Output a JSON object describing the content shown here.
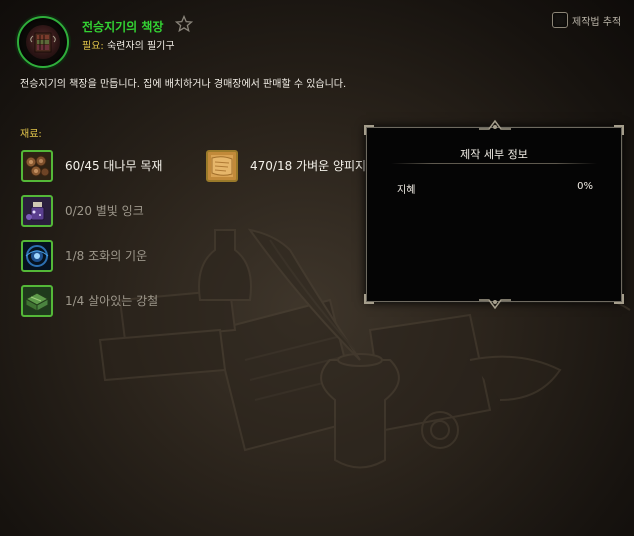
{
  "recipe": {
    "title": "전승지기의 책장",
    "required_label": "필요:",
    "required_value": "숙련자의 필기구",
    "description": "전승지기의 책장을 만듭니다. 집에 배치하거나 경매장에서 판매할 수 있습니다."
  },
  "tracking": {
    "label": "제작법 추적",
    "checked": false
  },
  "reagents": {
    "label": "재료:",
    "items": [
      {
        "text": "60/45 대나무 목재",
        "icon": "bamboo-lumber-icon",
        "enough": true
      },
      {
        "text": "470/18 가벼운 양피지",
        "icon": "light-parchment-icon",
        "enough": true
      },
      {
        "text": "0/20 별빛 잉크",
        "icon": "starlight-ink-icon",
        "enough": false
      },
      {
        "text": "1/8 조화의 기운",
        "icon": "spirit-of-harmony-icon",
        "enough": false
      },
      {
        "text": "1/4 살아있는 강철",
        "icon": "living-steel-icon",
        "enough": false
      }
    ]
  },
  "details": {
    "title": "제작 세부 정보",
    "stat_label": "지혜",
    "stat_value": "0%"
  },
  "colors": {
    "title_green": "#33d233",
    "label_gold": "#e1c54a",
    "icon_border_green": "#54b838"
  }
}
